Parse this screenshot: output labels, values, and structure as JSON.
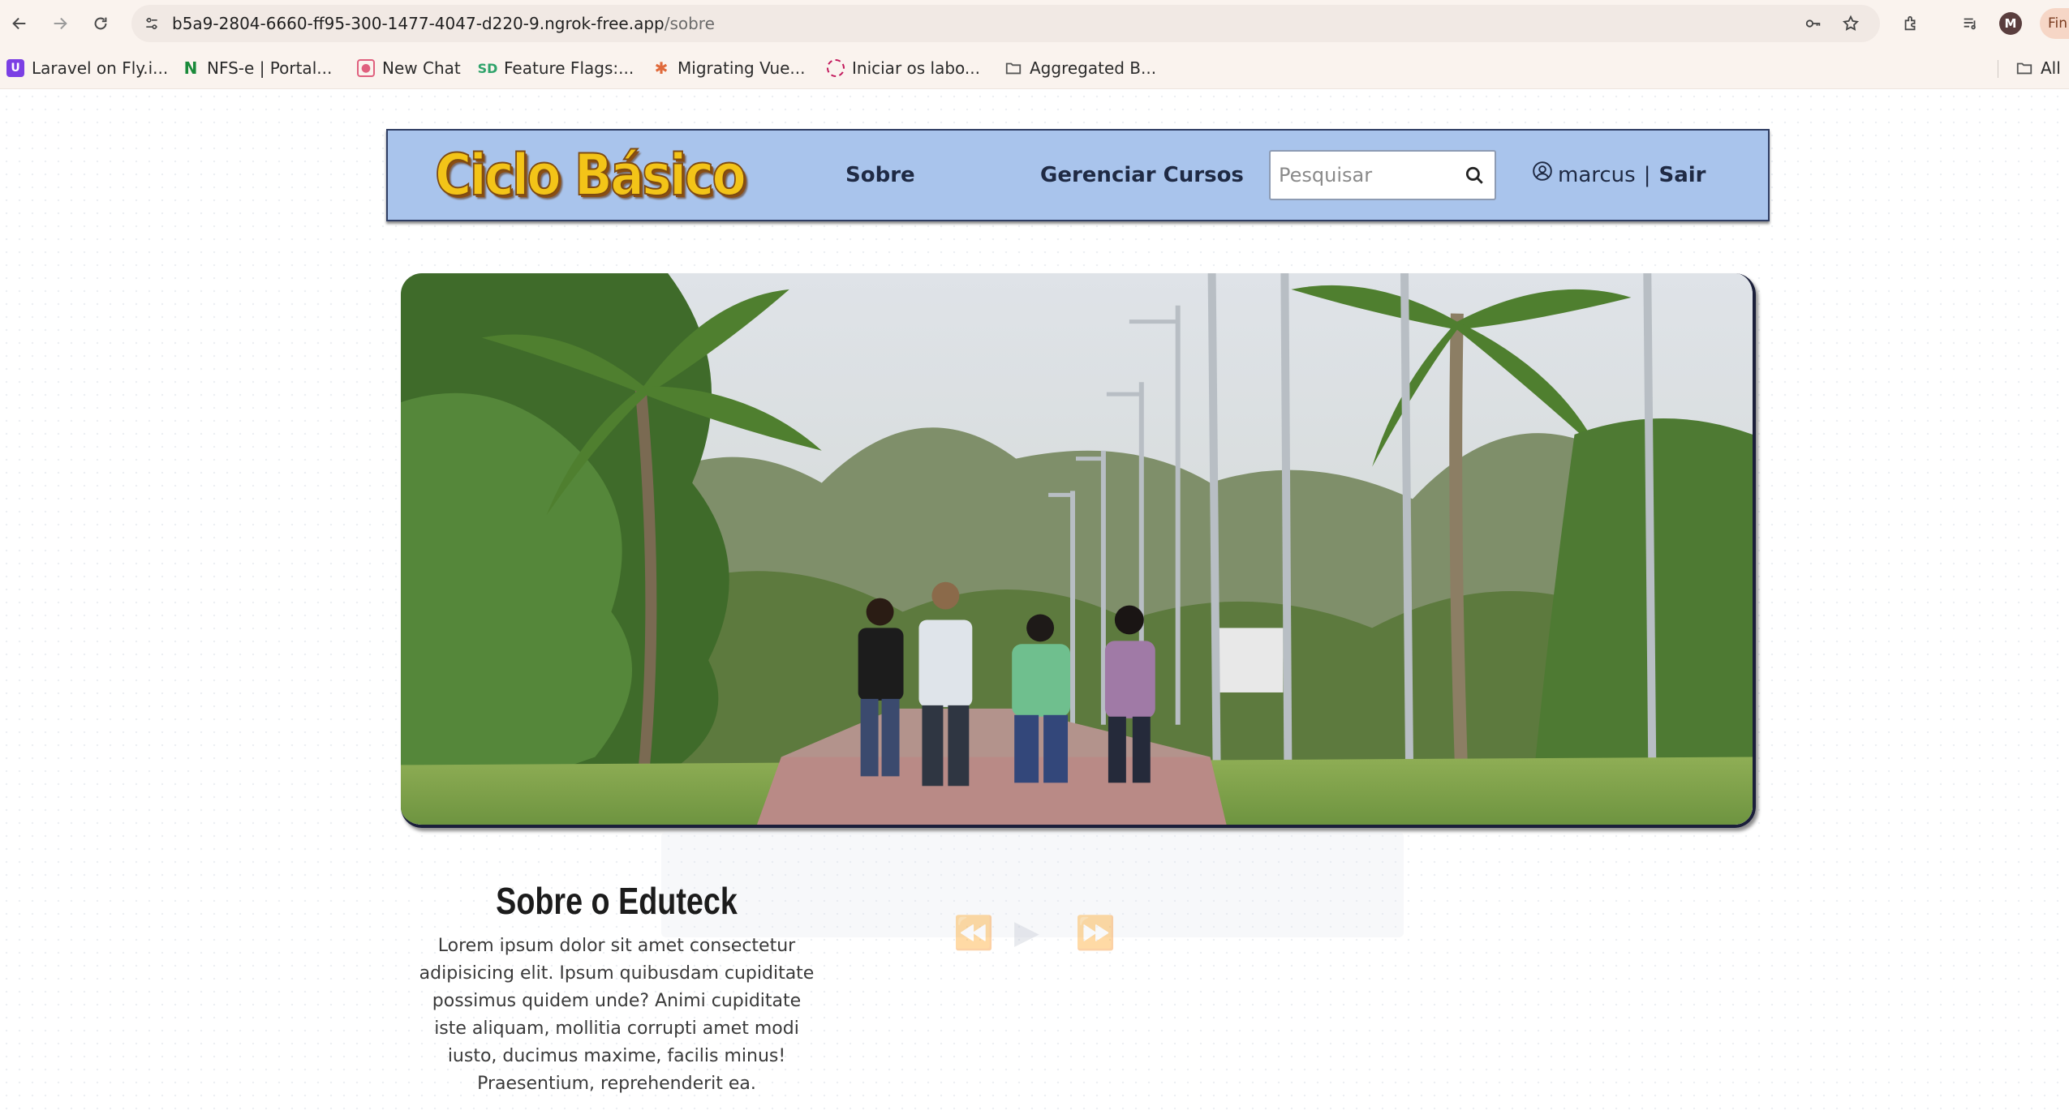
{
  "browser": {
    "url_main": "b5a9-2804-6660-ff95-300-1477-4047-d220-9.ngrok-free.app",
    "url_path": "/sobre",
    "profile_initial": "M",
    "finish_label": "Fin",
    "bookmarks": [
      {
        "label": "Laravel on Fly.i...",
        "icon": "laravel-icon",
        "color": "#7b3fe4"
      },
      {
        "label": "NFS-e | Portal...",
        "icon": "nfse-icon",
        "color": "#1a8a3a"
      },
      {
        "label": "New Chat",
        "icon": "chat-icon",
        "color": "#e0607e"
      },
      {
        "label": "Feature Flags:...",
        "icon": "feature-flags-icon",
        "color": "#2fa36b"
      },
      {
        "label": "Migrating Vue...",
        "icon": "migrating-icon",
        "color": "#e06a3b"
      },
      {
        "label": "Iniciar os labo...",
        "icon": "labs-icon",
        "color": "#c2185b"
      },
      {
        "label": "Aggregated B...",
        "icon": "folder-icon",
        "color": "#555555"
      }
    ],
    "all_bookmarks_label": "All"
  },
  "header": {
    "logo_text": "Ciclo Básico",
    "nav": {
      "about": "Sobre",
      "manage_courses": "Gerenciar Cursos"
    },
    "search_placeholder": "Pesquisar",
    "username": "marcus",
    "separator": "|",
    "logout": "Sair"
  },
  "about": {
    "title": "Sobre o Eduteck",
    "text": "Lorem ipsum dolor sit amet consectetur adipisicing elit. Ipsum quibusdam cupiditate possimus quidem unde? Animi cupiditate iste aliquam, mollitia corrupti amet modi iusto, ducimus maxime, facilis minus! Praesentium, reprehenderit ea."
  },
  "colors": {
    "header_bg": "#a9c4ec",
    "header_border": "#2f3d63",
    "logo_yellow": "#f3c418"
  }
}
